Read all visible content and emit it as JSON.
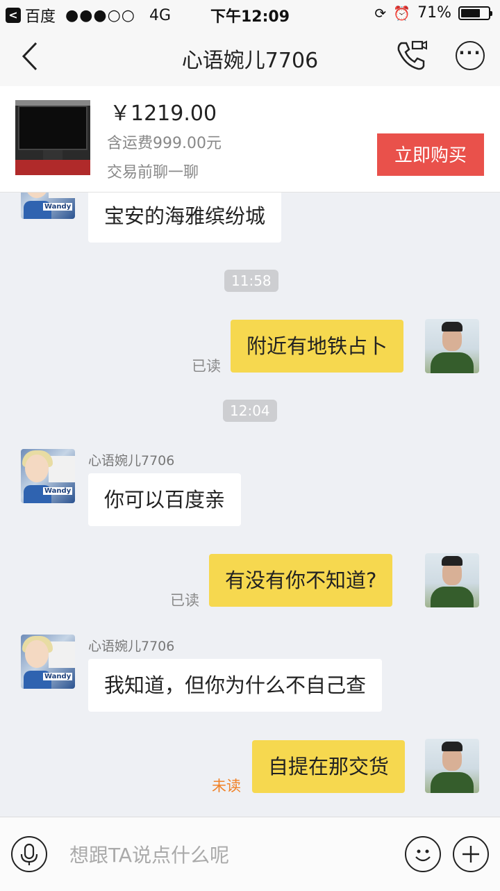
{
  "status_bar": {
    "back_app_glyph": "<",
    "back_app_label": "百度",
    "signal": "●●●○○",
    "network": "4G",
    "time": "下午12:09",
    "battery_text": "71%",
    "battery_level": 0.71
  },
  "nav": {
    "title": "心语婉儿7706"
  },
  "product": {
    "price": "￥1219.00",
    "shipping": "含运费999.00元",
    "chat_hint": "交易前聊一聊",
    "buy_label": "立即购买"
  },
  "chat": {
    "messages": [
      {
        "from": "other",
        "sender": "",
        "text": "宝安的海雅缤纷城"
      },
      {
        "type": "time",
        "text": "11:58"
      },
      {
        "from": "me",
        "text": "附近有地铁占卜",
        "status": "已读"
      },
      {
        "type": "time",
        "text": "12:04"
      },
      {
        "from": "other",
        "sender": "心语婉儿7706",
        "text": "你可以百度亲"
      },
      {
        "from": "me",
        "text": "有没有你不知道?",
        "status": "已读"
      },
      {
        "from": "other",
        "sender": "心语婉儿7706",
        "text": "我知道，但你为什么不自己查"
      },
      {
        "from": "me",
        "text": "自提在那交货",
        "status": "未读"
      }
    ],
    "avatar_tag": "Wandy"
  },
  "input_bar": {
    "placeholder": "想跟TA说点什么呢"
  },
  "colors": {
    "accent_buy": "#e9514b",
    "my_bubble": "#f6d84f",
    "unread": "#f08228"
  }
}
